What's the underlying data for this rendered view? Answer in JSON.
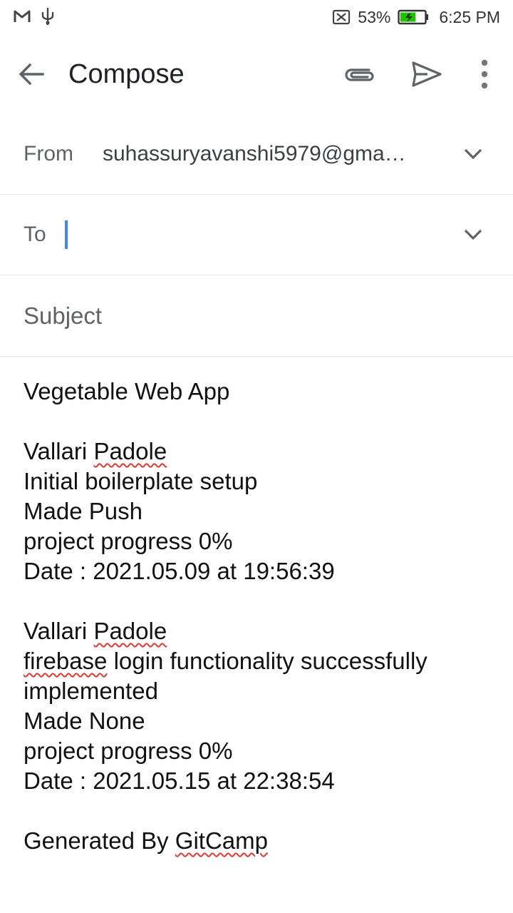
{
  "status_bar": {
    "battery_percent": "53%",
    "time": "6:25 PM",
    "icons": [
      "gmail-icon",
      "usb-icon",
      "no-sim-icon",
      "battery-charging-icon"
    ]
  },
  "app_bar": {
    "title": "Compose",
    "icons": [
      "back-arrow-icon",
      "attachment-icon",
      "send-icon",
      "more-vert-icon"
    ]
  },
  "from": {
    "label": "From",
    "value": "suhassuryavanshi5979@gma…"
  },
  "to": {
    "label": "To",
    "value": ""
  },
  "subject": {
    "placeholder": "Subject",
    "value": ""
  },
  "body": {
    "title": "Vegetable Web App",
    "entry1": {
      "author_first": "Vallari",
      "author_last": "Padole",
      "message": "Initial boilerplate setup",
      "made": "Made Push",
      "progress": "project progress 0%",
      "date": "Date : 2021.05.09 at 19:56:39"
    },
    "entry2": {
      "author_first": "Vallari",
      "author_last": "Padole",
      "message_word1": "firebase",
      "message_rest": "login functionality successfully",
      "message_line2": "implemented",
      "made": "Made None",
      "progress": "project progress 0%",
      "date": "Date : 2021.05.15 at 22:38:54"
    },
    "footer_prefix": "Generated By",
    "footer_brand": "GitCamp"
  },
  "colors": {
    "caret": "#4285f4",
    "spellcheck": "#e53935",
    "battery_fill": "#22c000"
  }
}
